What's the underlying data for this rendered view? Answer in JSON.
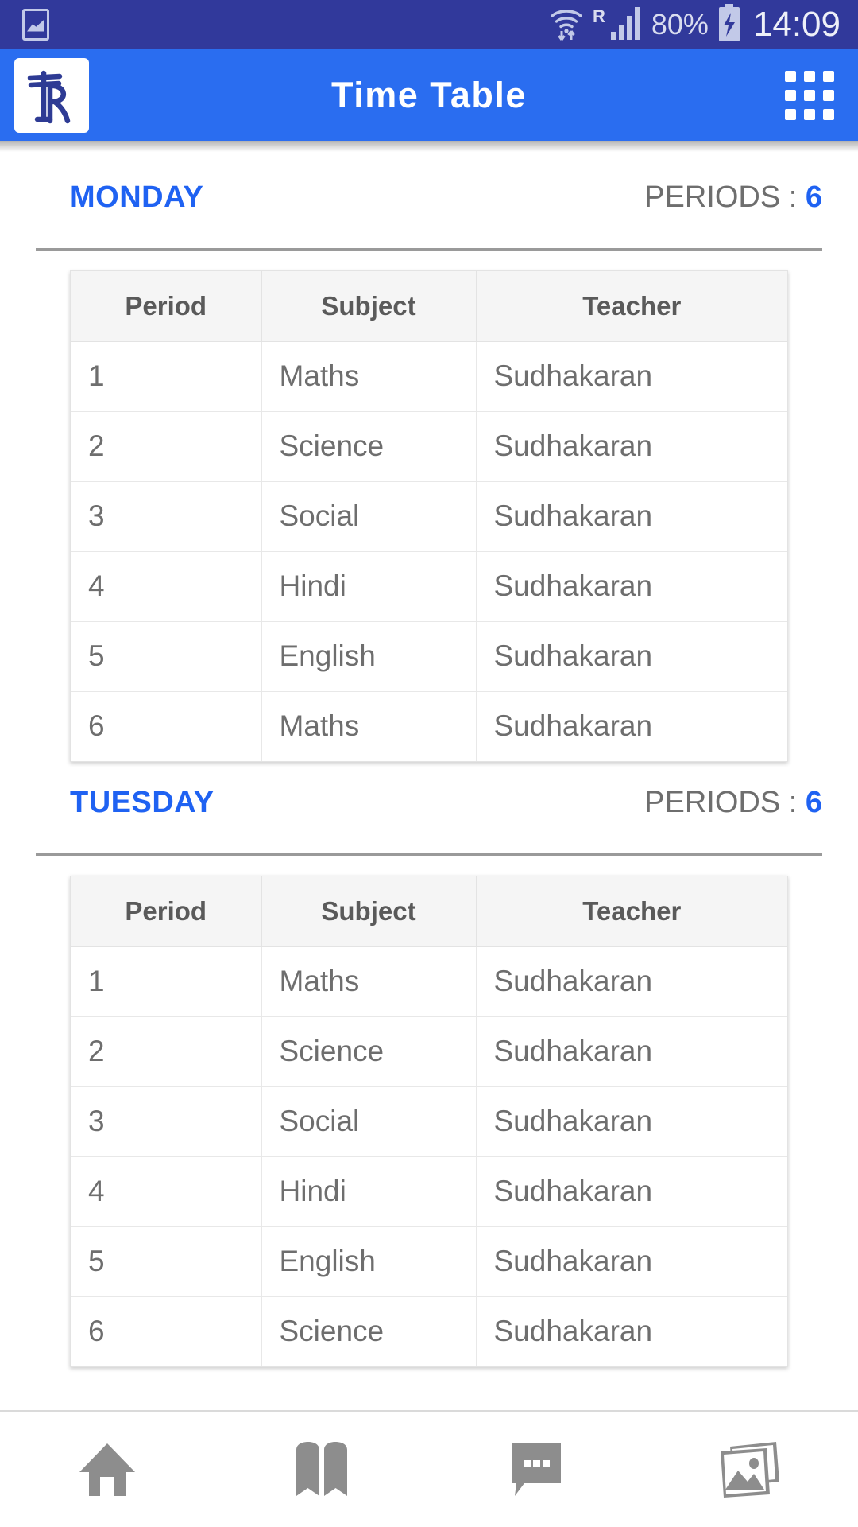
{
  "status_bar": {
    "background": "#31399b",
    "left_icon": "photo-gallery-icon",
    "roaming": "R",
    "battery_percent": "80%",
    "clock": "14:09",
    "icons": [
      "wifi-icon",
      "roaming-icon",
      "signal-icon",
      "battery-charging-icon"
    ]
  },
  "app_bar": {
    "background": "#2a6df0",
    "logo_text": "TR",
    "title": "Time Table",
    "menu_icon": "apps-grid-icon"
  },
  "table_headers": [
    "Period",
    "Subject",
    "Teacher"
  ],
  "periods_label_prefix": "PERIODS : ",
  "accent_color": "#1f62f2",
  "days": [
    {
      "name": "MONDAY",
      "periods_count": "6",
      "rows": [
        {
          "period": "1",
          "subject": "Maths",
          "teacher": "Sudhakaran"
        },
        {
          "period": "2",
          "subject": "Science",
          "teacher": "Sudhakaran"
        },
        {
          "period": "3",
          "subject": "Social",
          "teacher": "Sudhakaran"
        },
        {
          "period": "4",
          "subject": "Hindi",
          "teacher": "Sudhakaran"
        },
        {
          "period": "5",
          "subject": "English",
          "teacher": "Sudhakaran"
        },
        {
          "period": "6",
          "subject": "Maths",
          "teacher": "Sudhakaran"
        }
      ]
    },
    {
      "name": "TUESDAY",
      "periods_count": "6",
      "rows": [
        {
          "period": "1",
          "subject": "Maths",
          "teacher": "Sudhakaran"
        },
        {
          "period": "2",
          "subject": "Science",
          "teacher": "Sudhakaran"
        },
        {
          "period": "3",
          "subject": "Social",
          "teacher": "Sudhakaran"
        },
        {
          "period": "4",
          "subject": "Hindi",
          "teacher": "Sudhakaran"
        },
        {
          "period": "5",
          "subject": "English",
          "teacher": "Sudhakaran"
        },
        {
          "period": "6",
          "subject": "Science",
          "teacher": "Sudhakaran"
        }
      ]
    }
  ],
  "bottom_nav": [
    {
      "icon": "home-icon",
      "label": ""
    },
    {
      "icon": "book-icon",
      "label": ""
    },
    {
      "icon": "chat-icon",
      "label": ""
    },
    {
      "icon": "gallery-icon",
      "label": ""
    }
  ]
}
